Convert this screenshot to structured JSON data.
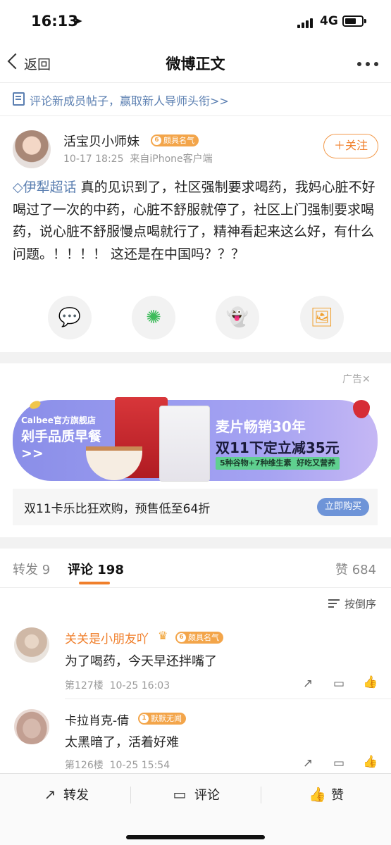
{
  "status_bar": {
    "time": "16:13",
    "network": "4G"
  },
  "nav": {
    "back_label": "返回",
    "title": "微博正文"
  },
  "notice": {
    "text": "评论新成员帖子，赢取新人导师头衔>>"
  },
  "post": {
    "author": "活宝贝小师妹",
    "author_badge": "颇具名气",
    "meta": "10-17 18:25  来自iPhone客户端",
    "follow_label": "＋关注",
    "topic": "伊犁超话",
    "body": " 真的见识到了，社区强制要求喝药，我妈心脏不好喝过了一次的中药，心脏不舒服就停了，社区上门强制要求喝药，说心脏不舒服慢点喝就行了，精神看起来这么好，有什么问题。！！！！ 这还是在中国吗？？？",
    "share_targets": [
      {
        "icon": "wechat-icon"
      },
      {
        "icon": "moments-icon"
      },
      {
        "icon": "qq-icon"
      },
      {
        "icon": "save-image-icon"
      }
    ]
  },
  "ad": {
    "tag": "广告✕",
    "store": "Calbee官方旗舰店",
    "slogan": "剁手品质早餐>>",
    "headline1": "麦片畅销30年",
    "headline2": "双11下定立减35元",
    "sub": "5种谷物+7种维生素  好吃又营养",
    "text": "双11卡乐比狂欢购，预售低至64折",
    "button": "立即购买"
  },
  "tabs": {
    "repost": "转发 9",
    "comment": "评论 198",
    "like": "赞 684"
  },
  "comments": {
    "sort_label": "按倒序",
    "items": [
      {
        "name": "关关是小朋友吖",
        "badge": "颇具名气",
        "text": "为了喝药，今天早还拌嘴了",
        "meta": "第127楼  10-25 16:03"
      },
      {
        "name": "卡拉肖克-倩",
        "badge": "默默无闻",
        "text": "太黑暗了，活着好难",
        "meta": "第126楼  10-25 15:54"
      }
    ]
  },
  "bottom_bar": {
    "repost": "转发",
    "comment": "评论",
    "like": "赞"
  },
  "colors": {
    "accent": "#f07f2b",
    "link": "#5b7fb1"
  }
}
